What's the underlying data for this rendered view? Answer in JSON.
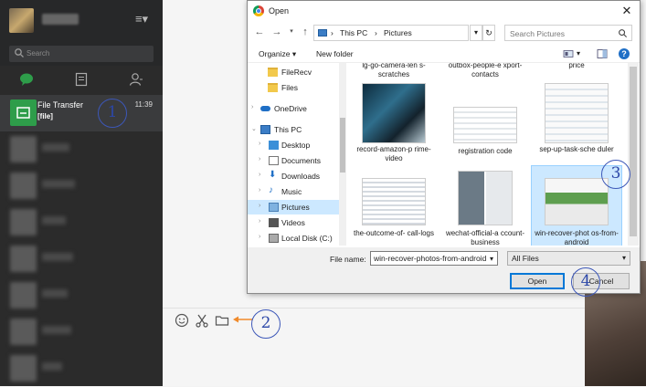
{
  "sidebar": {
    "search_placeholder": "Search",
    "active_chat": {
      "title": "File Transfer",
      "subtitle": "[file]",
      "time": "11:39"
    }
  },
  "dialog": {
    "title": "Open",
    "close": "✕",
    "address": {
      "root": "This PC",
      "current": "Pictures",
      "sep": "›"
    },
    "search_placeholder": "Search Pictures",
    "commands": {
      "organize": "Organize ▾",
      "new_folder": "New folder"
    },
    "nav": {
      "items": [
        {
          "label": "FileRecv"
        },
        {
          "label": "Files"
        },
        {
          "label": "OneDrive"
        },
        {
          "label": "This PC"
        },
        {
          "label": "Desktop"
        },
        {
          "label": "Documents"
        },
        {
          "label": "Downloads"
        },
        {
          "label": "Music"
        },
        {
          "label": "Pictures"
        },
        {
          "label": "Videos"
        },
        {
          "label": "Local Disk (C:)"
        }
      ]
    },
    "files": [
      {
        "caption": "lg-go-camera-len s-scratches"
      },
      {
        "caption": "outbox-people-e xport-contacts"
      },
      {
        "caption": "price"
      },
      {
        "caption": "record-amazon-p rime-video"
      },
      {
        "caption": "registration code"
      },
      {
        "caption": "sep-up-task-sche duler"
      },
      {
        "caption": "the-outcome-of- call-logs"
      },
      {
        "caption": "wechat-official-a ccount-business"
      },
      {
        "caption": "win-recover-phot os-from-android"
      }
    ],
    "file_name_label": "File name:",
    "file_name_value": "win-recover-photos-from-android",
    "file_type": "All Files",
    "open_label": "Open",
    "cancel_label": "Cancel"
  },
  "callouts": [
    "1",
    "2",
    "3",
    "4"
  ],
  "icons": {
    "menu": "menu-icon",
    "search": "search-icon",
    "chat": "chat-bubble-icon",
    "contacts": "contacts-icon",
    "favorites": "favorites-icon",
    "emoji": "emoji-icon",
    "scissors": "scissors-icon",
    "folder": "folder-icon"
  },
  "colors": {
    "wechat_green": "#2e9d4a",
    "selection": "#cce8ff",
    "callout": "#3c57b8",
    "arrow": "#f08a2a"
  }
}
